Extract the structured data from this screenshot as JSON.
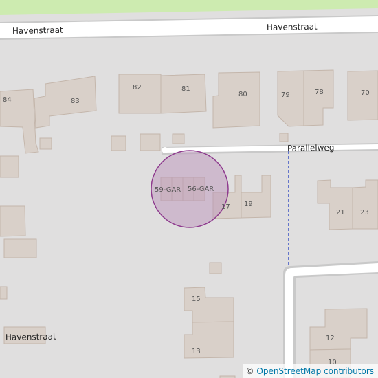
{
  "map": {
    "streets": {
      "havenstraat_top_left": "Havenstraat",
      "havenstraat_top_right": "Havenstraat",
      "parallelweg": "Parallelweg",
      "havenstraat_bottom": "Havenstraat"
    },
    "house_numbers": {
      "n84": "84",
      "n83": "83",
      "n82": "82",
      "n81": "81",
      "n80": "80",
      "n79": "79",
      "n78": "78",
      "n70": "70",
      "n59gar": "59-GAR",
      "n56gar": "56-GAR",
      "n17": "17",
      "n19": "19",
      "n21": "21",
      "n23": "23",
      "n15": "15",
      "n13": "13",
      "n12": "12",
      "n10": "10"
    },
    "colors": {
      "background": "#e0dfdf",
      "building": "#d9d0c9",
      "building_outline": "#c4b6ab",
      "road": "#ffffff",
      "grass": "#cdebb0",
      "footpath": "#3a52c4",
      "marker_fill": "#b88db8",
      "marker_stroke": "#8e3a8e"
    }
  },
  "attribution": {
    "copyright": "©",
    "link_text": "OpenStreetMap contributors"
  }
}
